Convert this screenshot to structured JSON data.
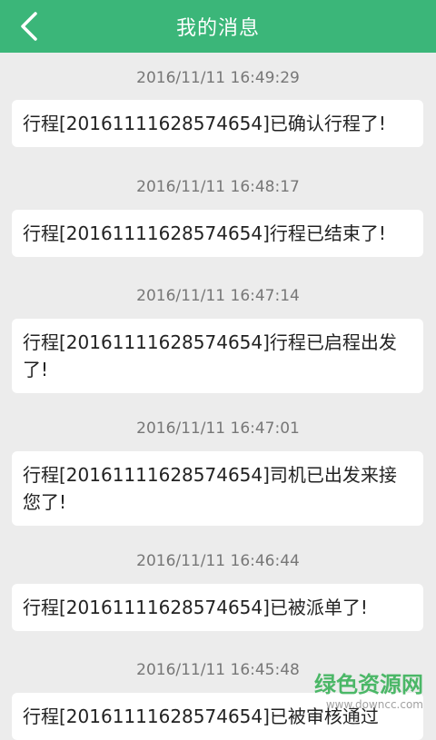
{
  "header": {
    "title": "我的消息",
    "back_icon": "chevron-left-icon"
  },
  "messages": [
    {
      "time": "2016/11/11 16:49:29",
      "text": "行程[20161111628574654]已确认行程了!"
    },
    {
      "time": "2016/11/11 16:48:17",
      "text": "行程[20161111628574654]行程已结束了!"
    },
    {
      "time": "2016/11/11 16:47:14",
      "text": "行程[20161111628574654]行程已启程出发了!"
    },
    {
      "time": "2016/11/11 16:47:01",
      "text": "行程[20161111628574654]司机已出发来接您了!"
    },
    {
      "time": "2016/11/11 16:46:44",
      "text": "行程[20161111628574654]已被派单了!"
    },
    {
      "time": "2016/11/11 16:45:48",
      "text": "行程[20161111628574654]已被审核通过"
    }
  ],
  "watermark": {
    "main": "绿色资源网",
    "sub": "www.downcc.com"
  },
  "colors": {
    "header_bg": "#3bb679",
    "background": "#ececec",
    "card_bg": "#ffffff",
    "time_text": "#777777"
  }
}
